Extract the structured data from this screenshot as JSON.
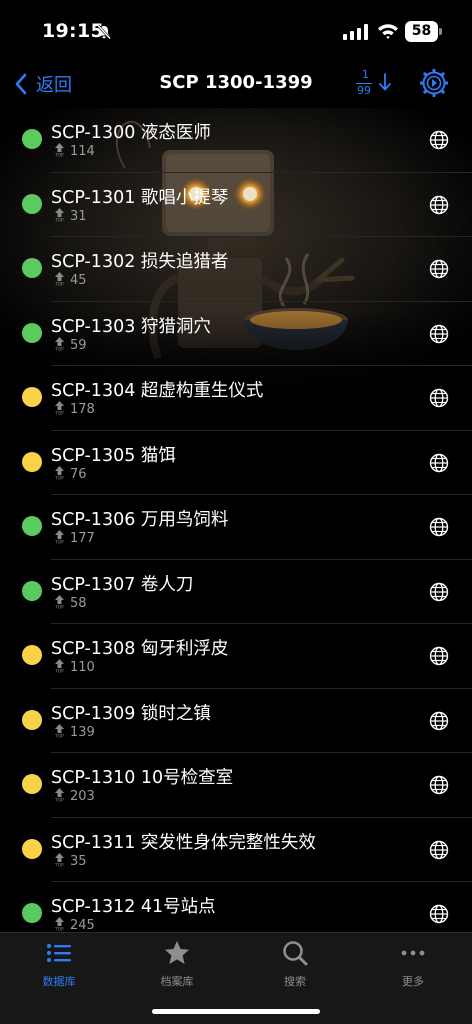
{
  "status_bar": {
    "time": "19:15",
    "battery": "58"
  },
  "nav": {
    "back_label": "返回",
    "title": "SCP 1300-1399",
    "range_start": "1",
    "range_end": "99"
  },
  "colors": {
    "accent": "#2f7cf6",
    "safe": "#5ccb5f",
    "euclid": "#f8d247",
    "background": "#000000"
  },
  "icons": {
    "rating": "top-arrow-icon",
    "language": "globe-icon",
    "settings": "gear-icon"
  },
  "rows": [
    {
      "title": "SCP-1300 液态医师",
      "rating": "114",
      "status": "safe"
    },
    {
      "title": "SCP-1301 歌唱小提琴",
      "rating": "31",
      "status": "safe"
    },
    {
      "title": "SCP-1302 损失追猎者",
      "rating": "45",
      "status": "safe"
    },
    {
      "title": "SCP-1303 狩猎洞穴",
      "rating": "59",
      "status": "safe"
    },
    {
      "title": "SCP-1304 超虚构重生仪式",
      "rating": "178",
      "status": "euclid"
    },
    {
      "title": "SCP-1305 猫饵",
      "rating": "76",
      "status": "euclid"
    },
    {
      "title": "SCP-1306 万用鸟饲料",
      "rating": "177",
      "status": "safe"
    },
    {
      "title": "SCP-1307 卷人刀",
      "rating": "58",
      "status": "safe"
    },
    {
      "title": "SCP-1308 匈牙利浮皮",
      "rating": "110",
      "status": "euclid"
    },
    {
      "title": "SCP-1309 锁时之镇",
      "rating": "139",
      "status": "euclid"
    },
    {
      "title": "SCP-1310 10号检查室",
      "rating": "203",
      "status": "euclid"
    },
    {
      "title": "SCP-1311 突发性身体完整性失效",
      "rating": "35",
      "status": "euclid"
    },
    {
      "title": "SCP-1312 41号站点",
      "rating": "245",
      "status": "safe"
    }
  ],
  "tabs": [
    {
      "label": "数据库",
      "icon": "list-icon",
      "active": true
    },
    {
      "label": "档案库",
      "icon": "star-icon",
      "active": false
    },
    {
      "label": "搜索",
      "icon": "search-icon",
      "active": false
    },
    {
      "label": "更多",
      "icon": "more-icon",
      "active": false
    }
  ]
}
